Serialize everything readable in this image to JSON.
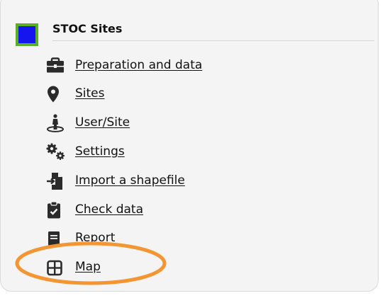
{
  "section": {
    "title": "STOC Sites"
  },
  "menu": {
    "items": [
      {
        "label": "Preparation and data",
        "icon": "briefcase-icon"
      },
      {
        "label": "Sites",
        "icon": "map-marker-icon"
      },
      {
        "label": "User/Site",
        "icon": "person-pin-icon"
      },
      {
        "label": "Settings",
        "icon": "gears-icon"
      },
      {
        "label": "Import a shapefile",
        "icon": "file-import-icon"
      },
      {
        "label": "Check data",
        "icon": "clipboard-check-icon"
      },
      {
        "label": "Report",
        "icon": "report-icon"
      },
      {
        "label": "Map",
        "icon": "grid-icon"
      }
    ]
  },
  "colors": {
    "logo_fill": "#1515f0",
    "logo_border": "#5cae26",
    "highlight_ellipse": "#f39533",
    "icon": "#2b2b2b"
  }
}
